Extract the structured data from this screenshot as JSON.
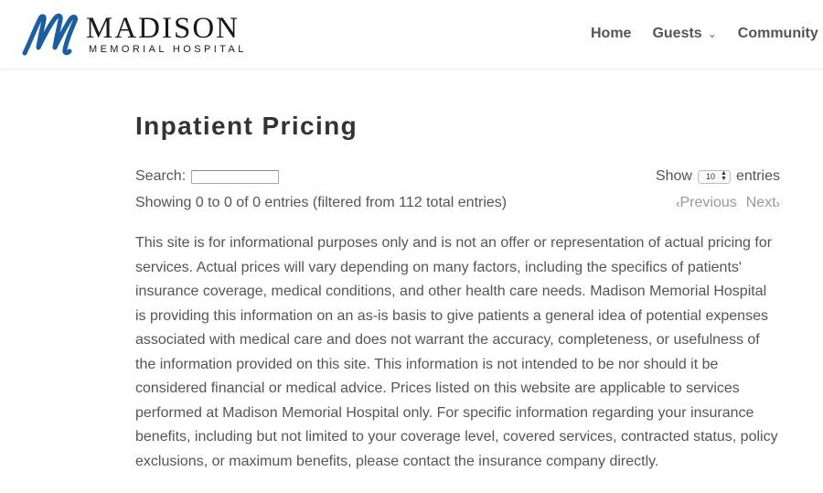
{
  "header": {
    "logo": {
      "name": "MADISON",
      "subtitle": "MEMORIAL HOSPITAL",
      "mark_color": "#1d5f9e"
    },
    "nav": [
      {
        "label": "Home",
        "has_dropdown": false
      },
      {
        "label": "Guests",
        "has_dropdown": true,
        "icon": "chevron-down-icon"
      },
      {
        "label": "Community In",
        "has_dropdown": false
      }
    ]
  },
  "main": {
    "title": "Inpatient Pricing",
    "search": {
      "label": "Search:",
      "value": "",
      "placeholder": ""
    },
    "length": {
      "show_label": "Show",
      "selected": "10",
      "entries_label": "entries"
    },
    "info": "Showing 0 to 0 of 0 entries (filtered from 112 total entries)",
    "pagination": {
      "previous": "Previous",
      "next": "Next",
      "prev_icon": "chevron-left-icon",
      "next_icon": "chevron-right-icon",
      "disabled_color": "#999999"
    },
    "disclaimer": "This site is for informational purposes only and is not an offer or representation of actual pricing for services. Actual prices will vary depending on many factors, including the specifics of patients' insurance coverage, medical conditions, and other health care needs. Madison Memorial Hospital is providing this information on an as-is basis to give patients a general idea of potential expenses associated with medical care and does not warrant the accuracy, completeness, or usefulness of the information provided on this site. This information is not intended to be nor should it be considered financial or medical advice. Prices listed on this website are applicable to services performed at Madison Memorial Hospital only. For specific information regarding your insurance benefits, including but not limited to your coverage level, covered services, contracted status, policy exclusions, or maximum benefits, please contact the insurance company directly."
  }
}
